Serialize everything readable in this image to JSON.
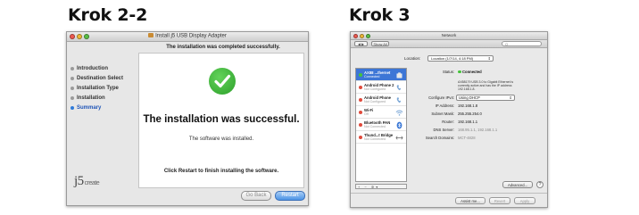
{
  "steps": {
    "left_title": "Krok 2-2",
    "right_title": "Krok 3"
  },
  "installer": {
    "window_title": "Install j5 USB Display Adapter",
    "header": "The installation was completed successfully.",
    "nav": [
      {
        "label": "Introduction",
        "active": false
      },
      {
        "label": "Destination Select",
        "active": false
      },
      {
        "label": "Installation Type",
        "active": false
      },
      {
        "label": "Installation",
        "active": false
      },
      {
        "label": "Summary",
        "active": true
      }
    ],
    "success_heading": "The installation was successful.",
    "installed_msg": "The software was installed.",
    "restart_msg": "Click Restart to finish installing the software.",
    "logo_main": "j5",
    "logo_sub": "create",
    "go_back_label": "Go Back",
    "restart_label": "Restart"
  },
  "network": {
    "window_title": "Network",
    "nav_arrows": "◀ ▶",
    "show_all": "Show All",
    "search_placeholder": "Q",
    "location_label": "Location:",
    "location_value": "Location (1/7/14, 4:18 PM)",
    "services": [
      {
        "name": "AX88 ...thernet",
        "status": "Connected",
        "dot": "green",
        "icon": "ethernet-icon",
        "selected": true
      },
      {
        "name": "Android Phone 2",
        "status": "Not Configured",
        "dot": "red",
        "icon": "phone-icon",
        "selected": false
      },
      {
        "name": "Android Phone",
        "status": "Not Configured",
        "dot": "red",
        "icon": "phone-icon",
        "selected": false
      },
      {
        "name": "Wi-Fi",
        "status": "Off",
        "dot": "red",
        "icon": "wifi-icon",
        "selected": false
      },
      {
        "name": "Bluetooth PAN",
        "status": "Not Connected",
        "dot": "red",
        "icon": "bluetooth-icon",
        "selected": false
      },
      {
        "name": "Thund...t Bridge",
        "status": "Not Connected",
        "dot": "red",
        "icon": "bridge-icon",
        "selected": false
      }
    ],
    "list_footer": "+ − ✲▾",
    "details": {
      "status_label": "Status:",
      "status_value": "Connected",
      "status_desc": "AX88179 USB 3.0 to Gigabit Ethernet is currently active and has the IP address 192.168.1.8.",
      "configure_label": "Configure IPv4:",
      "configure_value": "Using DHCP",
      "ip_label": "IP Address:",
      "ip_value": "192.168.1.8",
      "mask_label": "Subnet Mask:",
      "mask_value": "255.255.254.0",
      "router_label": "Router:",
      "router_value": "192.168.1.1",
      "dns_label": "DNS Server:",
      "dns_value": "168.95.1.1, 192.168.1.1",
      "search_label": "Search Domains:",
      "search_value": "MCT-4828"
    },
    "advanced_label": "Advanced...",
    "help_label": "?",
    "assist_label": "Assist me...",
    "revert_label": "Revert",
    "apply_label": "Apply"
  },
  "colors": {
    "accent": "#3d76d6",
    "success_green": "#2c9f2a",
    "status_red": "#e04a3c"
  }
}
